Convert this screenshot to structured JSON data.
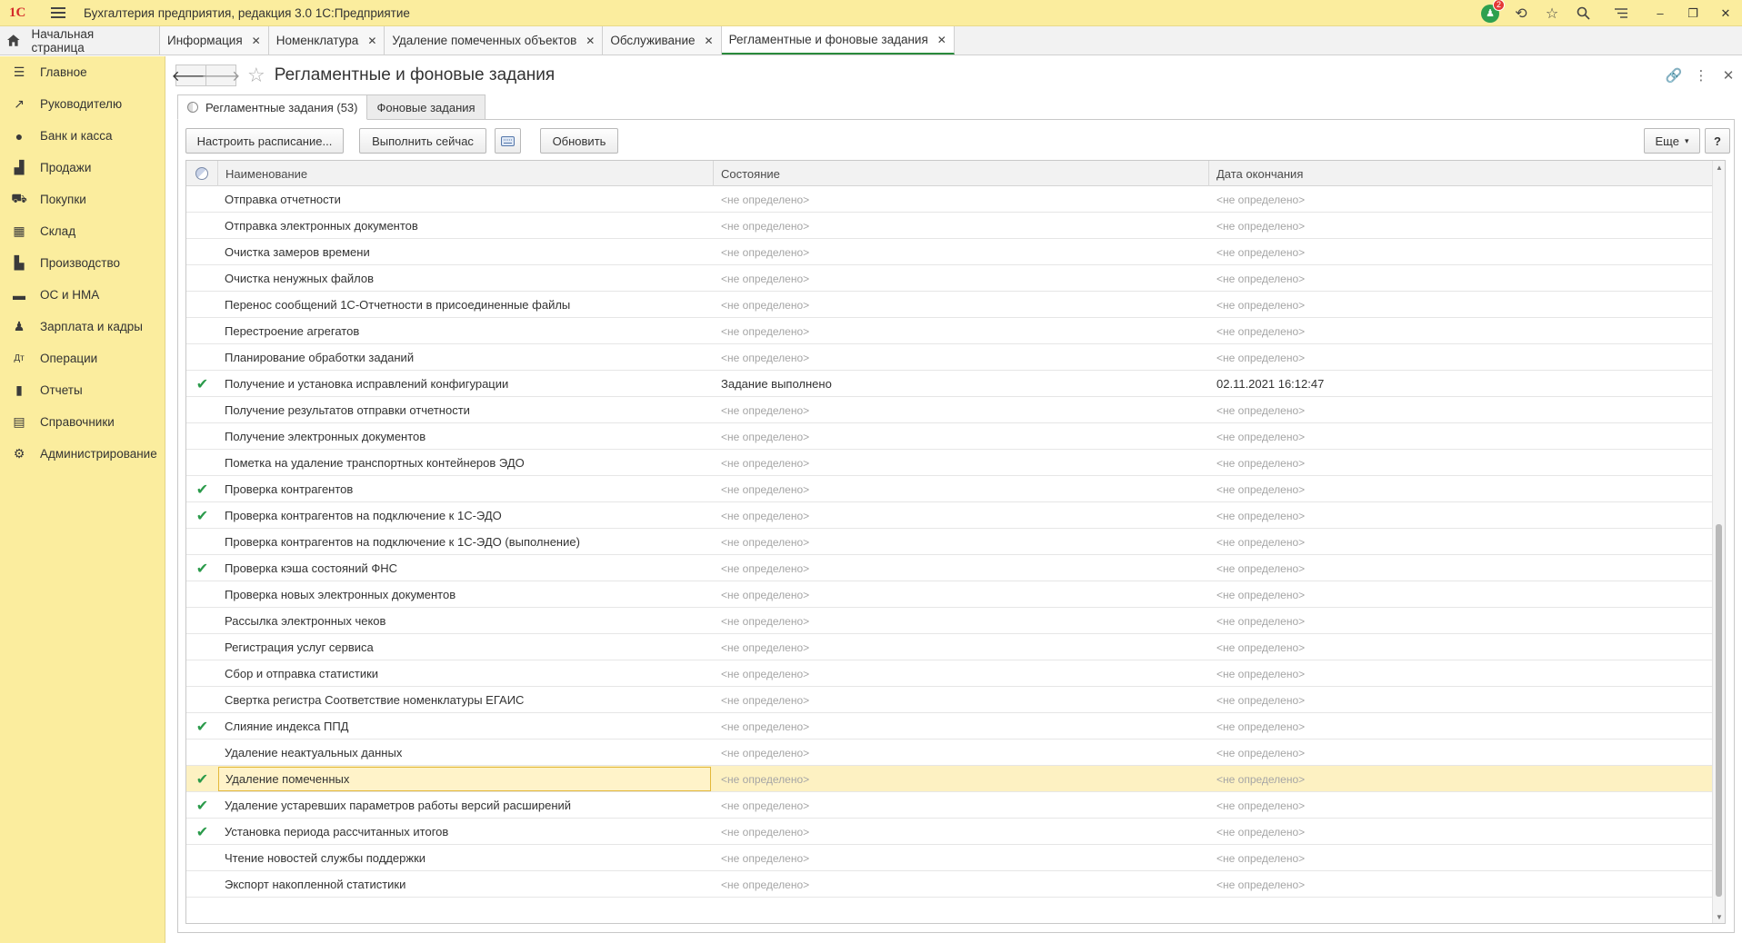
{
  "app": {
    "title": "Бухгалтерия предприятия, редакция 3.0 1С:Предприятие",
    "logo_text": "1С",
    "notifications_count": "2"
  },
  "tabs": {
    "home": "Начальная страница",
    "items": [
      {
        "label": "Информация"
      },
      {
        "label": "Номенклатура"
      },
      {
        "label": "Удаление помеченных объектов"
      },
      {
        "label": "Обслуживание"
      },
      {
        "label": "Регламентные и фоновые задания"
      }
    ]
  },
  "sidebar": {
    "items": [
      {
        "label": "Главное",
        "icon": "menu-icon"
      },
      {
        "label": "Руководителю",
        "icon": "trend-icon"
      },
      {
        "label": "Банк и касса",
        "icon": "coin-icon"
      },
      {
        "label": "Продажи",
        "icon": "bag-icon"
      },
      {
        "label": "Покупки",
        "icon": "cart-icon"
      },
      {
        "label": "Склад",
        "icon": "warehouse-icon"
      },
      {
        "label": "Производство",
        "icon": "factory-icon"
      },
      {
        "label": "ОС и НМА",
        "icon": "truck-icon"
      },
      {
        "label": "Зарплата и кадры",
        "icon": "person-icon"
      },
      {
        "label": "Операции",
        "icon": "operations-icon"
      },
      {
        "label": "Отчеты",
        "icon": "bar-chart-icon"
      },
      {
        "label": "Справочники",
        "icon": "book-icon"
      },
      {
        "label": "Администрирование",
        "icon": "gear-icon"
      }
    ]
  },
  "form": {
    "title": "Регламентные и фоновые задания",
    "tab_scheduled": "Регламентные задания (53)",
    "tab_background": "Фоновые задания"
  },
  "toolbar": {
    "configure": "Настроить расписание...",
    "run_now": "Выполнить сейчас",
    "refresh": "Обновить",
    "more": "Еще",
    "help": "?"
  },
  "table": {
    "columns": [
      "Наименование",
      "Состояние",
      "Дата окончания"
    ],
    "rows": [
      {
        "check": "",
        "name": "Отправка отчетности",
        "state": "<не определено>",
        "date": "<не определено>"
      },
      {
        "check": "",
        "name": "Отправка электронных документов",
        "state": "<не определено>",
        "date": "<не определено>"
      },
      {
        "check": "",
        "name": "Очистка замеров времени",
        "state": "<не определено>",
        "date": "<не определено>"
      },
      {
        "check": "",
        "name": "Очистка ненужных файлов",
        "state": "<не определено>",
        "date": "<не определено>"
      },
      {
        "check": "",
        "name": "Перенос сообщений 1С-Отчетности в присоединенные файлы",
        "state": "<не определено>",
        "date": "<не определено>"
      },
      {
        "check": "",
        "name": "Перестроение агрегатов",
        "state": "<не определено>",
        "date": "<не определено>"
      },
      {
        "check": "",
        "name": "Планирование обработки заданий",
        "state": "<не определено>",
        "date": "<не определено>"
      },
      {
        "check": "✔",
        "name": "Получение и установка исправлений конфигурации",
        "state": "Задание выполнено",
        "date": "02.11.2021 16:12:47"
      },
      {
        "check": "",
        "name": "Получение результатов отправки отчетности",
        "state": "<не определено>",
        "date": "<не определено>"
      },
      {
        "check": "",
        "name": "Получение электронных документов",
        "state": "<не определено>",
        "date": "<не определено>"
      },
      {
        "check": "",
        "name": "Пометка на удаление транспортных контейнеров ЭДО",
        "state": "<не определено>",
        "date": "<не определено>"
      },
      {
        "check": "✔",
        "name": "Проверка контрагентов",
        "state": "<не определено>",
        "date": "<не определено>"
      },
      {
        "check": "✔",
        "name": "Проверка контрагентов на подключение к 1С-ЭДО",
        "state": "<не определено>",
        "date": "<не определено>"
      },
      {
        "check": "",
        "name": "Проверка контрагентов на подключение к 1С-ЭДО (выполнение)",
        "state": "<не определено>",
        "date": "<не определено>"
      },
      {
        "check": "✔",
        "name": "Проверка кэша состояний ФНС",
        "state": "<не определено>",
        "date": "<не определено>"
      },
      {
        "check": "",
        "name": "Проверка новых электронных документов",
        "state": "<не определено>",
        "date": "<не определено>"
      },
      {
        "check": "",
        "name": "Рассылка электронных чеков",
        "state": "<не определено>",
        "date": "<не определено>"
      },
      {
        "check": "",
        "name": "Регистрация услуг сервиса",
        "state": "<не определено>",
        "date": "<не определено>"
      },
      {
        "check": "",
        "name": "Сбор и отправка статистики",
        "state": "<не определено>",
        "date": "<не определено>"
      },
      {
        "check": "",
        "name": "Свертка регистра Соответствие номенклатуры ЕГАИС",
        "state": "<не определено>",
        "date": "<не определено>"
      },
      {
        "check": "✔",
        "name": "Слияние индекса ППД",
        "state": "<не определено>",
        "date": "<не определено>"
      },
      {
        "check": "",
        "name": "Удаление неактуальных данных",
        "state": "<не определено>",
        "date": "<не определено>"
      },
      {
        "check": "✔",
        "name": "Удаление помеченных",
        "state": "<не определено>",
        "date": "<не определено>",
        "selected": true
      },
      {
        "check": "✔",
        "name": "Удаление устаревших параметров работы версий расширений",
        "state": "<не определено>",
        "date": "<не определено>"
      },
      {
        "check": "✔",
        "name": "Установка периода рассчитанных итогов",
        "state": "<не определено>",
        "date": "<не определено>"
      },
      {
        "check": "",
        "name": "Чтение новостей службы поддержки",
        "state": "<не определено>",
        "date": "<не определено>"
      },
      {
        "check": "",
        "name": "Экспорт накопленной статистики",
        "state": "<не определено>",
        "date": "<не определено>"
      }
    ]
  },
  "colors": {
    "sidebar_bg": "#fbed9e",
    "accent_green": "#2a9a4a",
    "selection": "#fdf1c2"
  }
}
